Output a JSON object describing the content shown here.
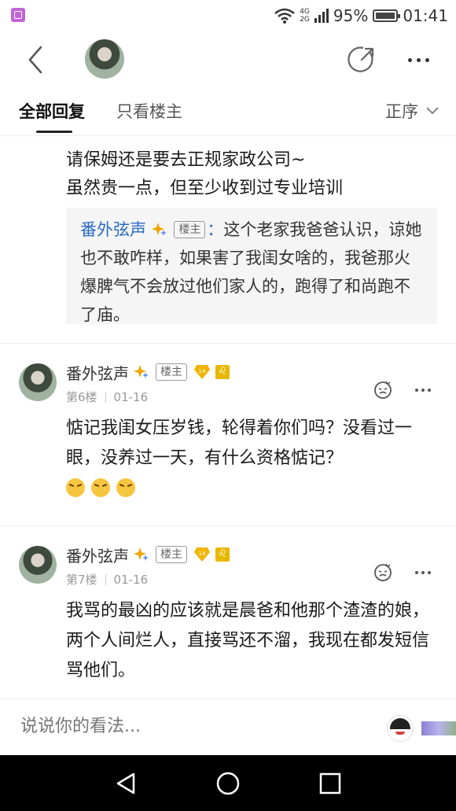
{
  "status_bar": {
    "network": [
      "4G",
      "2G"
    ],
    "battery": "95%",
    "time": "01:41"
  },
  "tabs": {
    "all": "全部回复",
    "op_only": "只看楼主",
    "sort": "正序"
  },
  "continuation": {
    "lines": [
      "请保姆还是要去正规家政公司~",
      "虽然贵一点，但至少收到过专业培训"
    ],
    "quote": {
      "name": "番外弦声",
      "badge": "楼主",
      "colon": "：",
      "text": "这个老家我爸爸认识，谅她也不敢咋样，如果害了我闺女啥的，我爸那火爆脾气不会放过他们家人的，跑得了和尚跑不了庙。"
    }
  },
  "comments": [
    {
      "name": "番外弦声",
      "badge": "楼主",
      "level": "14",
      "floor": "第6楼",
      "date": "01-16",
      "text": "惦记我闺女压岁钱，轮得着你们吗？没看过一眼，没养过一天，有什么资格惦记？",
      "emoji_icons": [
        "angry-face-icon",
        "angry-face-icon",
        "angry-face-icon"
      ]
    },
    {
      "name": "番外弦声",
      "badge": "楼主",
      "level": "14",
      "floor": "第7楼",
      "date": "01-16",
      "text": "我骂的最凶的应该就是晨爸和他那个渣渣的娘，两个人间烂人，直接骂还不溜，我现在都发短信骂他们。"
    }
  ],
  "input": {
    "placeholder": "说说你的看法..."
  },
  "colors": {
    "link_blue": "#2a6bc4",
    "gold": "#e8b800",
    "nav_bg": "#000000"
  }
}
